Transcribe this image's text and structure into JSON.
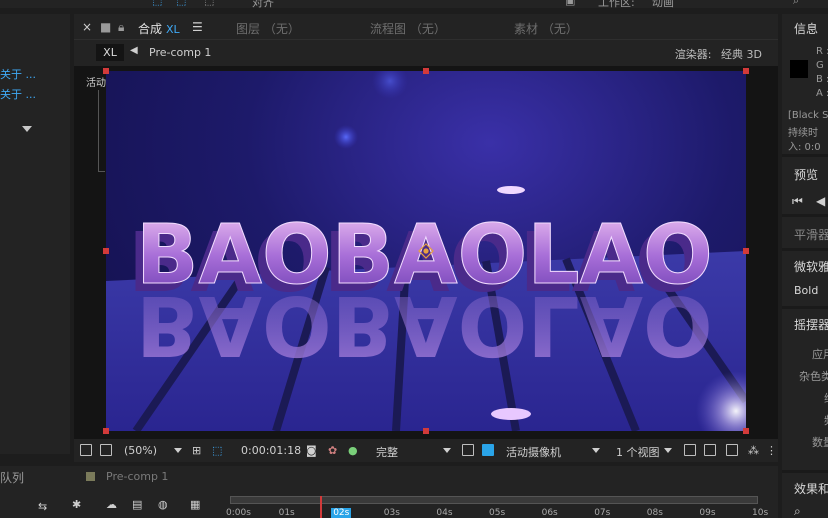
{
  "menubar": {
    "partial_left": "对齐",
    "workspace_label": "工作区:",
    "workspace_value": "动画"
  },
  "left_panel": {
    "links": [
      "关于 ...",
      "关于 ..."
    ]
  },
  "comp_panel": {
    "tabs": [
      {
        "label": "合成",
        "sub": "XL",
        "active": true
      },
      {
        "label": "图层 （无）"
      },
      {
        "label": "流程图 （无）"
      },
      {
        "label": "素材 （无）"
      }
    ],
    "current_comp": "XL",
    "breadcrumb_item": "Pre-comp 1",
    "renderer_label": "渲染器:",
    "renderer_value": "经典 3D",
    "camera_label": "活动摄像机",
    "preview_text": "BAOBAOLAO",
    "reflection_text": "BAOBAOLAO"
  },
  "viewer_toolbar": {
    "zoom": "(50%)",
    "timecode": "0:00:01:18",
    "resolution": "完整",
    "view_camera": "活动摄像机",
    "view_count": "1 个视图"
  },
  "right_panel": {
    "info_title": "信息",
    "info_rows": [
      "R :",
      "G :",
      "B :",
      "A :"
    ],
    "info_extra": [
      "[Black S",
      "持续时",
      "入: 0:0"
    ],
    "preview_title": "预览",
    "smoother_title": "平滑器",
    "font_name": "微软雅",
    "font_style": "Bold",
    "wiggler_title": "摇摆器",
    "wiggler_rows": [
      "应用",
      "杂色类",
      "维",
      "频",
      "数量"
    ],
    "effects_title": "效果和"
  },
  "timeline": {
    "queue_tab": "队列",
    "comp_tab": "Pre-comp 1",
    "ticks": [
      "0:00s",
      "01s",
      "02s",
      "03s",
      "04s",
      "05s",
      "06s",
      "07s",
      "08s",
      "09s",
      "10s"
    ],
    "current_tick": "02s"
  }
}
